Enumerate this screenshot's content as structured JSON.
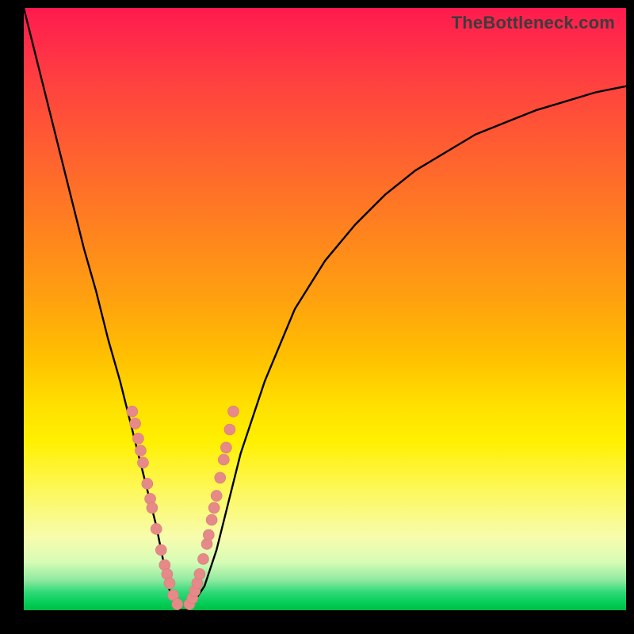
{
  "watermark": "TheBottleneck.com",
  "chart_data": {
    "type": "line",
    "title": "",
    "xlabel": "",
    "ylabel": "",
    "xlim": [
      0,
      100
    ],
    "ylim": [
      0,
      100
    ],
    "grid": false,
    "legend": false,
    "series": [
      {
        "name": "bottleneck-curve",
        "x": [
          0,
          2,
          4,
          6,
          8,
          10,
          12,
          14,
          16,
          18,
          20,
          21,
          22,
          23,
          24,
          25,
          26,
          27,
          28,
          30,
          32,
          34,
          36,
          40,
          45,
          50,
          55,
          60,
          65,
          70,
          75,
          80,
          85,
          90,
          95,
          100
        ],
        "y": [
          100,
          92,
          84,
          76,
          68,
          60,
          53,
          45,
          38,
          30,
          22,
          18,
          14,
          9,
          4,
          1,
          0,
          0,
          1,
          4,
          10,
          18,
          26,
          38,
          50,
          58,
          64,
          69,
          73,
          76,
          79,
          81,
          83,
          84.5,
          86,
          87
        ]
      }
    ],
    "annotations": [],
    "clusters": {
      "left": {
        "name": "left-point-cluster",
        "points": [
          {
            "x": 18.0,
            "y": 33.0
          },
          {
            "x": 18.5,
            "y": 31.0
          },
          {
            "x": 19.0,
            "y": 28.5
          },
          {
            "x": 19.4,
            "y": 26.5
          },
          {
            "x": 19.8,
            "y": 24.5
          },
          {
            "x": 20.5,
            "y": 21.0
          },
          {
            "x": 21.0,
            "y": 18.5
          },
          {
            "x": 21.3,
            "y": 17.0
          },
          {
            "x": 22.0,
            "y": 13.5
          },
          {
            "x": 22.8,
            "y": 10.0
          },
          {
            "x": 23.4,
            "y": 7.5
          },
          {
            "x": 23.8,
            "y": 6.0
          },
          {
            "x": 24.2,
            "y": 4.5
          },
          {
            "x": 24.8,
            "y": 2.5
          },
          {
            "x": 25.5,
            "y": 1.0
          }
        ]
      },
      "right": {
        "name": "right-point-cluster",
        "points": [
          {
            "x": 27.5,
            "y": 1.0
          },
          {
            "x": 28.0,
            "y": 2.0
          },
          {
            "x": 28.4,
            "y": 3.2
          },
          {
            "x": 28.8,
            "y": 4.5
          },
          {
            "x": 29.2,
            "y": 6.0
          },
          {
            "x": 29.8,
            "y": 8.5
          },
          {
            "x": 30.4,
            "y": 11.0
          },
          {
            "x": 30.7,
            "y": 12.5
          },
          {
            "x": 31.2,
            "y": 15.0
          },
          {
            "x": 31.6,
            "y": 17.0
          },
          {
            "x": 32.0,
            "y": 19.0
          },
          {
            "x": 32.6,
            "y": 22.0
          },
          {
            "x": 33.2,
            "y": 25.0
          },
          {
            "x": 33.6,
            "y": 27.0
          },
          {
            "x": 34.2,
            "y": 30.0
          },
          {
            "x": 34.8,
            "y": 33.0
          }
        ]
      }
    },
    "cluster_point_radius": 7,
    "background_gradient": {
      "top": "#ff1a4d",
      "mid_upper": "#ff8020",
      "mid": "#ffe000",
      "mid_lower": "#f7fcae",
      "bottom": "#00cc55"
    }
  }
}
